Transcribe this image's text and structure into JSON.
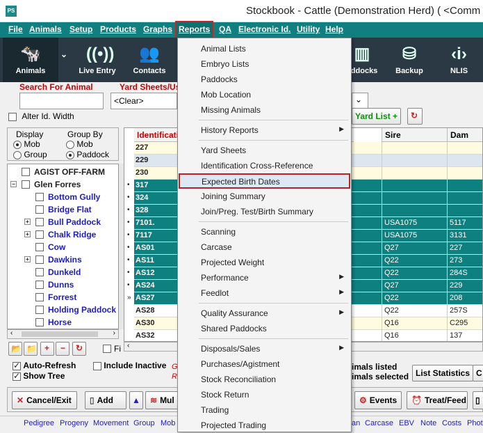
{
  "window": {
    "title": "Stockbook - Cattle (Demonstration Herd) ( <Comm",
    "app_icon": "PS"
  },
  "menubar": [
    "File",
    "Animals",
    "Setup",
    "Products",
    "Graphs",
    "Reports",
    "QA",
    "Electronic Id.",
    "Utility",
    "Help"
  ],
  "toolbar": {
    "animals": "Animals",
    "live_entry": "Live Entry",
    "contacts": "Contacts",
    "paddocks": "addocks",
    "backup": "Backup",
    "nlis": "NLIS"
  },
  "search": {
    "label": "Search For Animal",
    "yard_label": "Yard Sheets/Us",
    "yard_value": "<Clear>",
    "alter_label": "Alter Id. Width",
    "yard_list_btn": "Yard List +"
  },
  "display": {
    "title": "Display",
    "opt_mob": "Mob",
    "opt_group": "Group",
    "groupby_title": "Group By",
    "gb_mob": "Mob",
    "gb_paddock": "Paddock"
  },
  "tree": [
    {
      "label": "AGIST OFF-FARM",
      "color": "black",
      "indent": 0,
      "expander": ""
    },
    {
      "label": "Glen Forres",
      "color": "black",
      "indent": 0,
      "expander": "−"
    },
    {
      "label": "Bottom Gully",
      "color": "blue",
      "indent": 1,
      "expander": ""
    },
    {
      "label": "Bridge Flat",
      "color": "blue",
      "indent": 1,
      "expander": ""
    },
    {
      "label": "Bull Paddock",
      "color": "blue",
      "indent": 1,
      "expander": "+"
    },
    {
      "label": "Chalk Ridge",
      "color": "blue",
      "indent": 1,
      "expander": "+"
    },
    {
      "label": "Cow",
      "color": "blue",
      "indent": 1,
      "expander": ""
    },
    {
      "label": "Dawkins",
      "color": "blue",
      "indent": 1,
      "expander": "+"
    },
    {
      "label": "Dunkeld",
      "color": "blue",
      "indent": 1,
      "expander": ""
    },
    {
      "label": "Dunns",
      "color": "blue",
      "indent": 1,
      "expander": ""
    },
    {
      "label": "Forrest",
      "color": "blue",
      "indent": 1,
      "expander": ""
    },
    {
      "label": "Holding Paddock",
      "color": "blue",
      "indent": 1,
      "expander": ""
    },
    {
      "label": "Horse",
      "color": "blue",
      "indent": 1,
      "expander": ""
    }
  ],
  "grid": {
    "col_id": "Identification",
    "col_sire": "Sire",
    "col_dam": "Dam",
    "rows": [
      {
        "id": "227",
        "sire": "",
        "dam": "",
        "style": "yellow",
        "dot": ""
      },
      {
        "id": "229",
        "sire": "",
        "dam": "",
        "style": "blue",
        "dot": ""
      },
      {
        "id": "230",
        "sire": "",
        "dam": "",
        "style": "yellow",
        "dot": ""
      },
      {
        "id": "317",
        "sire": "",
        "dam": "",
        "style": "teal",
        "dot": "•"
      },
      {
        "id": "324",
        "sire": "",
        "dam": "",
        "style": "teal",
        "dot": "•"
      },
      {
        "id": "328",
        "sire": "",
        "dam": "",
        "style": "teal",
        "dot": "•"
      },
      {
        "id": "7101.",
        "sire": "USA1075",
        "dam": "5117",
        "style": "teal",
        "dot": "•"
      },
      {
        "id": "7117",
        "sire": "USA1075",
        "dam": "3131",
        "style": "teal",
        "dot": "•"
      },
      {
        "id": "AS01",
        "sire": "Q27",
        "dam": "227",
        "style": "teal",
        "dot": "•"
      },
      {
        "id": "AS11",
        "sire": "Q22",
        "dam": "273",
        "style": "teal",
        "dot": "•"
      },
      {
        "id": "AS12",
        "sire": "Q22",
        "dam": "284S",
        "style": "teal",
        "dot": "•"
      },
      {
        "id": "AS24",
        "sire": "Q27",
        "dam": "229",
        "style": "teal",
        "dot": "•"
      },
      {
        "id": "AS27",
        "sire": "Q22",
        "dam": "208",
        "style": "teal",
        "dot": "»"
      },
      {
        "id": "AS28",
        "sire": "Q22",
        "dam": "257S",
        "style": "white",
        "dot": ""
      },
      {
        "id": "AS30",
        "sire": "Q16",
        "dam": "C295",
        "style": "yellow",
        "dot": ""
      },
      {
        "id": "AS32",
        "sire": "Q16",
        "dam": "137",
        "style": "white",
        "dot": ""
      }
    ]
  },
  "reports_menu": [
    {
      "label": "Animal Lists",
      "arrow": false
    },
    {
      "label": "Embryo Lists",
      "arrow": false
    },
    {
      "label": "Paddocks",
      "arrow": false
    },
    {
      "label": "Mob Location",
      "arrow": false
    },
    {
      "label": "Missing Animals",
      "arrow": false
    },
    {
      "sep": true
    },
    {
      "label": "History Reports",
      "arrow": true
    },
    {
      "sep": true
    },
    {
      "label": "Yard Sheets",
      "arrow": false
    },
    {
      "label": "Identification Cross-Reference",
      "arrow": false
    },
    {
      "label": "Expected Birth Dates",
      "arrow": false,
      "highlight": true
    },
    {
      "label": "Joining Summary",
      "arrow": false
    },
    {
      "label": "Join/Preg. Test/Birth Summary",
      "arrow": false
    },
    {
      "sep": true
    },
    {
      "label": "Scanning",
      "arrow": false
    },
    {
      "label": "Carcase",
      "arrow": false
    },
    {
      "label": "Projected Weight",
      "arrow": false
    },
    {
      "label": "Performance",
      "arrow": true
    },
    {
      "label": "Feedlot",
      "arrow": true
    },
    {
      "sep": true
    },
    {
      "label": "Quality Assurance",
      "arrow": true
    },
    {
      "label": "Shared Paddocks",
      "arrow": false
    },
    {
      "sep": true
    },
    {
      "label": "Disposals/Sales",
      "arrow": true
    },
    {
      "label": "Purchases/Agistment",
      "arrow": false
    },
    {
      "label": "Stock Reconciliation",
      "arrow": false
    },
    {
      "label": "Stock Return",
      "arrow": false
    },
    {
      "label": "Trading",
      "arrow": false
    },
    {
      "label": "Projected Trading",
      "arrow": false
    }
  ],
  "status": {
    "auto_refresh": "Auto-Refresh",
    "show_tree": "Show Tree",
    "include_inactive": "Include Inactive",
    "animals_listed": "imals listed",
    "animals_selected": "imals selected",
    "list_statistics": "List Statistics",
    "c_btn": "C",
    "red_g": "G",
    "red_r": "R",
    "fi_label": "Fi"
  },
  "buttons": {
    "cancel": "Cancel/Exit",
    "add": "Add",
    "mul": "Mul",
    "events": "Events",
    "treat": "Treat/Feed"
  },
  "bottom_links": [
    "Pedigree",
    "Progeny",
    "Movement",
    "Group",
    "Mob",
    "an",
    "Carcase",
    "EBV",
    "Note",
    "Costs",
    "Phot"
  ]
}
